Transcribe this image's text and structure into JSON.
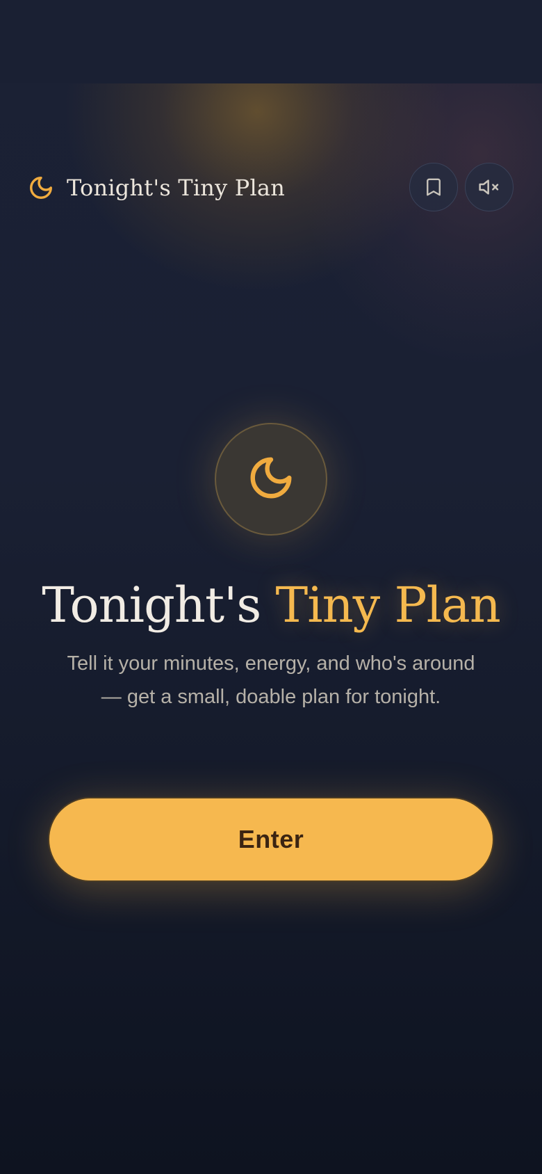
{
  "header": {
    "brand_icon": "moon-icon",
    "brand_name": "Tonight's Tiny Plan",
    "bookmark_button": {
      "icon": "bookmark-icon"
    },
    "mute_button": {
      "icon": "speaker-muted-icon"
    }
  },
  "hero": {
    "icon": "moon-icon",
    "title_main": "Tonight's ",
    "title_accent": "Tiny Plan",
    "subtitle": "Tell it your minutes, energy, and who's around — get a small, doable plan for tonight.",
    "cta_label": "Enter"
  },
  "colors": {
    "accent": "#f5b94f",
    "button_bg": "#f6b84f",
    "button_text": "#3b2412",
    "background": "#1a2033",
    "text_primary": "#f1ece4",
    "text_secondary": "#b6b1a8"
  }
}
